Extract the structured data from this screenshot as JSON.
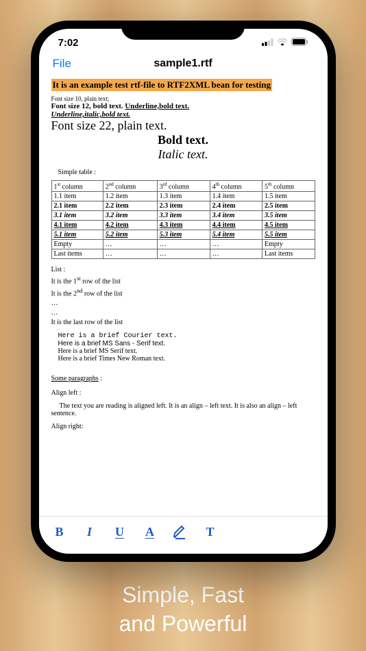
{
  "status": {
    "time": "7:02"
  },
  "nav": {
    "file": "File",
    "title": "sample1.rtf"
  },
  "doc": {
    "heading": "It is an example test rtf-file to RTF2XML bean for testing",
    "line_font10": "Font size 10, plain text;",
    "line_font12_a": "Font size 12, bold text. ",
    "line_font12_b": "Underline,bold text.",
    "line_font12_c": "Underline,italic,bold text.",
    "line_font22": "Font size 22, plain text.",
    "bold_text": "Bold text.",
    "italic_text": "Italic text.",
    "simple_table": "Simple table :",
    "table": {
      "headers": [
        "1ˢᵗ column",
        "2ⁿᵈ column",
        "3ʳᵈ column",
        "4ᵗʰ column",
        "5ᵗʰ column"
      ],
      "rows": [
        [
          "1.1 item",
          "1.2 item",
          "1.3 item",
          "1.4 item",
          "1.5 item"
        ],
        [
          "2.1 item",
          "2.2 item",
          "2.3 item",
          "2.4 item",
          "2.5 item"
        ],
        [
          "3.1 item",
          "3.2 item",
          "3.3 item",
          "3.4 item",
          "3.5 item"
        ],
        [
          "4.1 item",
          "4.2 item",
          "4.3 item",
          "4.4 item",
          "4.5 item"
        ],
        [
          "5.1 item",
          "5.2 item",
          "5.3 item",
          "5.4 item",
          "5.5 item"
        ],
        [
          "Empty",
          "…",
          "…",
          "…",
          "Empty"
        ],
        [
          "Last items",
          "…",
          "…",
          "…",
          "Last items"
        ]
      ]
    },
    "list_label": "List :",
    "list_r1a": "It is the 1",
    "list_r1b": " row of the list",
    "list_r2a": "It is the 2",
    "list_r2b": " row of the list",
    "list_last": "It is the last row of the list",
    "ellipsis": "…",
    "courier": "Here is a brief Courier text.",
    "sans": "Here is a brief MS Sans - Serif text.",
    "msserif": "Here is a brief MS Serif text.",
    "tnr": "Here is a brief Times New Roman text.",
    "some_para": "Some paragraphs",
    "some_para_colon": " :",
    "align_left": "Align left :",
    "align_left_text": "The text you are reading is aligned left. It is an align – left text. It is also an align – left sentence.",
    "align_right": "Align right:"
  },
  "tagline": {
    "l1": "Simple, Fast",
    "l2": "and Powerful"
  }
}
